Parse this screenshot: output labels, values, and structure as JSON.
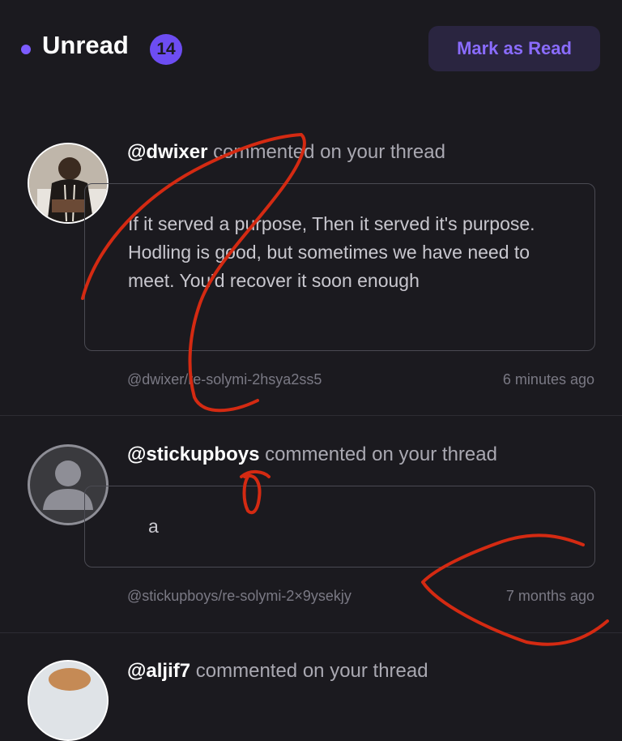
{
  "header": {
    "title": "Unread",
    "count": "14",
    "mark_button": "Mark as Read"
  },
  "notifications": [
    {
      "username": "@dwixer",
      "action": "commented on your thread",
      "body": "If it served a purpose, Then it served it's purpose. Hodling is good, but sometimes we have need to meet. You'd recover it soon enough",
      "permlink": "@dwixer/re-solymi-2hsya2ss5",
      "time": "6 minutes ago"
    },
    {
      "username": "@stickupboys",
      "action": "commented on your thread",
      "body": "a",
      "permlink": "@stickupboys/re-solymi-2×9ysekjy",
      "time": "7 months ago"
    },
    {
      "username": "@aljif7",
      "action": "commented on your thread"
    }
  ],
  "colors": {
    "accent": "#7c5cff",
    "background": "#1b1a1f",
    "annotation": "#d42a12"
  }
}
